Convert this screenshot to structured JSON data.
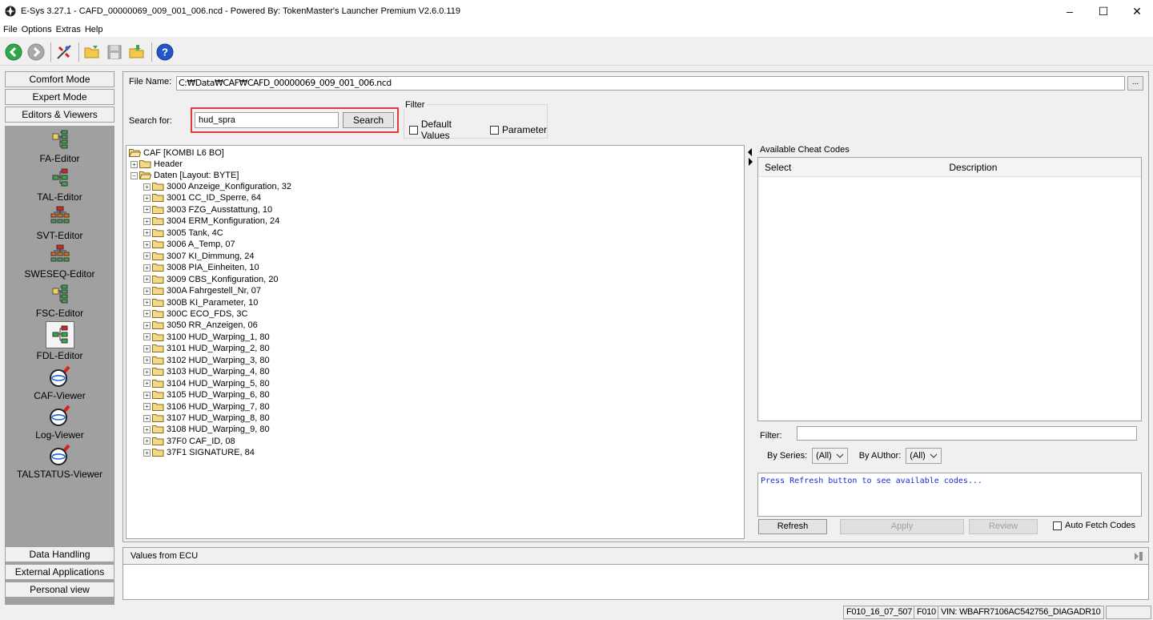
{
  "window": {
    "title": "E-Sys 3.27.1 - CAFD_00000069_009_001_006.ncd   - Powered By: TokenMaster's Launcher Premium V2.6.0.119",
    "controls": {
      "minimize": "–",
      "maximize": "☐",
      "close": "✕"
    }
  },
  "menu": [
    "File",
    "Options",
    "Extras",
    "Help"
  ],
  "toolbar": {
    "icons": [
      "back-icon",
      "forward-icon",
      "connect-icon",
      "open-folder-icon",
      "save-icon",
      "open-file-icon",
      "help-icon"
    ]
  },
  "left_panel": {
    "top_buttons": [
      "Comfort Mode",
      "Expert Mode",
      "Editors & Viewers"
    ],
    "tools": [
      "FA-Editor",
      "TAL-Editor",
      "SVT-Editor",
      "SWESEQ-Editor",
      "FSC-Editor",
      "FDL-Editor",
      "CAF-Viewer",
      "Log-Viewer",
      "TALSTATUS-Viewer"
    ],
    "selected_tool": "FDL-Editor",
    "bottom_buttons": [
      "Data Handling",
      "External Applications",
      "Personal view"
    ]
  },
  "file": {
    "label": "File Name:",
    "value": "C:₩Data₩CAF₩CAFD_00000069_009_001_006.ncd",
    "browse": "..."
  },
  "search": {
    "label": "Search for:",
    "value": "hud_spra",
    "button": "Search"
  },
  "filter": {
    "title": "Filter",
    "default_values": "Default Values",
    "parameter": "Parameter"
  },
  "tree": {
    "root": "CAF [KOMBI L6 BO]",
    "header": "Header",
    "daten": "Daten [Layout: BYTE]",
    "items": [
      "3000 Anzeige_Konfiguration, 32",
      "3001 CC_ID_Sperre, 64",
      "3003 FZG_Ausstattung, 10",
      "3004 ERM_Konfiguration, 24",
      "3005 Tank, 4C",
      "3006 A_Temp, 07",
      "3007 KI_Dimmung, 24",
      "3008 PIA_Einheiten, 10",
      "3009 CBS_Konfiguration, 20",
      "300A Fahrgestell_Nr, 07",
      "300B KI_Parameter, 10",
      "300C ECO_FDS, 3C",
      "3050 RR_Anzeigen, 06",
      "3100 HUD_Warping_1, 80",
      "3101 HUD_Warping_2, 80",
      "3102 HUD_Warping_3, 80",
      "3103 HUD_Warping_4, 80",
      "3104 HUD_Warping_5, 80",
      "3105 HUD_Warping_6, 80",
      "3106 HUD_Warping_7, 80",
      "3107 HUD_Warping_8, 80",
      "3108 HUD_Warping_9, 80",
      "37F0 CAF_ID, 08",
      "37F1 SIGNATURE, 84"
    ]
  },
  "cheat": {
    "title": "Available Cheat Codes",
    "col_select": "Select",
    "col_description": "Description",
    "filter_label": "Filter:",
    "by_series_label": "By Series:",
    "by_series_value": "(All)",
    "by_author_label": "By AUthor:",
    "by_author_value": "(All)",
    "message": "Press Refresh button to see available codes...",
    "refresh": "Refresh",
    "apply": "Apply",
    "review": "Review",
    "auto_fetch": "Auto Fetch Codes"
  },
  "ecu": {
    "title": "Values from ECU"
  },
  "status": {
    "cell1": "F010_16_07_507",
    "cell2": "F010",
    "cell3": "VIN: WBAFR7106AC542756_DIAGADR10"
  }
}
